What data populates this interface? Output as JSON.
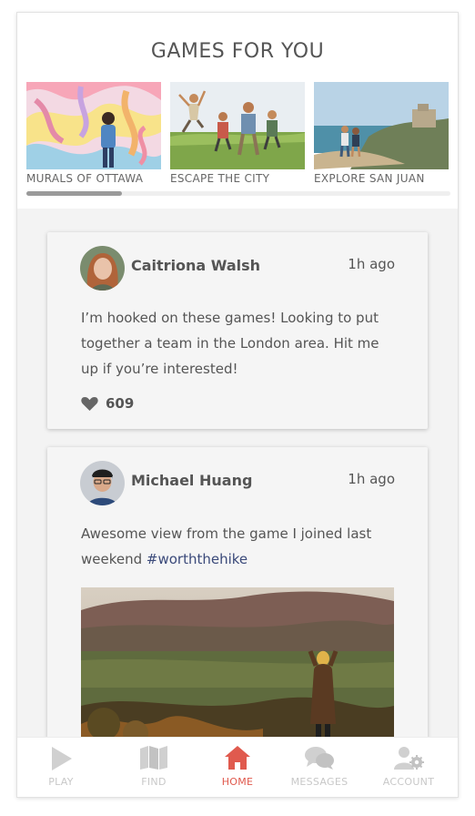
{
  "section_title": "GAMES FOR YOU",
  "games": [
    {
      "label": "MURALS OF OTTAWA"
    },
    {
      "label": "ESCAPE THE CITY"
    },
    {
      "label": "EXPLORE SAN JUAN"
    }
  ],
  "posts": [
    {
      "author": "Caitriona Walsh",
      "time": "1h ago",
      "text": "I’m hooked on these games! Looking to put together a team in the London area. Hit me up if you’re interested!",
      "likes": "609"
    },
    {
      "author": "Michael Huang",
      "time": "1h ago",
      "text": "Awesome view from the game I joined last weekend ",
      "hashtag": "#worththehike"
    }
  ],
  "tabs": [
    {
      "label": "PLAY",
      "icon": "play-icon"
    },
    {
      "label": "FIND",
      "icon": "map-icon"
    },
    {
      "label": "HOME",
      "icon": "home-icon"
    },
    {
      "label": "MESSAGES",
      "icon": "messages-icon"
    },
    {
      "label": "ACCOUNT",
      "icon": "account-settings-icon"
    }
  ],
  "colors": {
    "accent": "#e05a4e",
    "inactive": "#c8c8c8",
    "hashtag": "#3b4a7a"
  }
}
